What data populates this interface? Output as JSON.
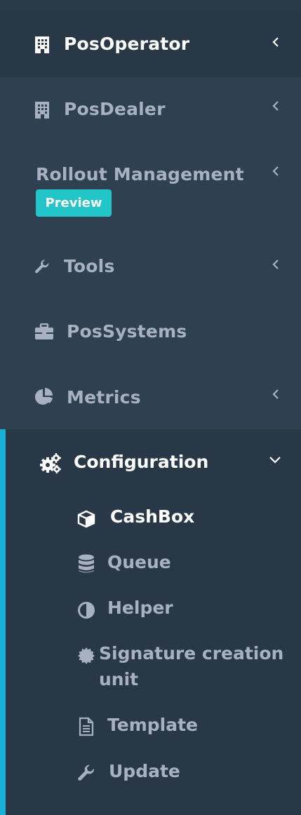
{
  "nav": {
    "items": [
      {
        "label": "PosOperator",
        "icon": "building-icon"
      },
      {
        "label": "PosDealer",
        "icon": "building-icon"
      },
      {
        "label": "Rollout Management",
        "badge": "Preview"
      },
      {
        "label": "Tools",
        "icon": "wrench-icon"
      },
      {
        "label": "PosSystems",
        "icon": "briefcase-icon"
      },
      {
        "label": "Metrics",
        "icon": "pie-chart-icon"
      }
    ]
  },
  "config": {
    "label": "Configuration",
    "icon": "cogs-icon",
    "items": [
      {
        "label": "CashBox",
        "icon": "cube-icon"
      },
      {
        "label": "Queue",
        "icon": "database-icon"
      },
      {
        "label": "Helper",
        "icon": "adjust-icon"
      },
      {
        "label": "Signature creation",
        "label2": "unit",
        "icon": "certificate-icon"
      },
      {
        "label": "Template",
        "icon": "file-text-icon"
      },
      {
        "label": "Update",
        "icon": "wrench-icon"
      }
    ]
  },
  "colors": {
    "sidebar_bg": "#2f4050",
    "active_bg": "#293846",
    "accent": "#1ab0d5",
    "badge": "#23c6c8",
    "text_muted": "#a7b1c2",
    "text_active": "#ffffff"
  }
}
